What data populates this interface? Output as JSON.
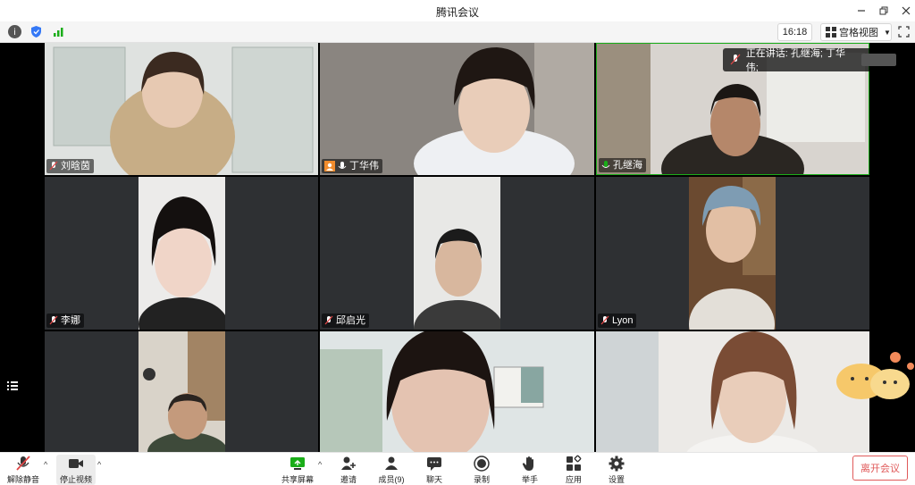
{
  "app": {
    "title": "腾讯会议"
  },
  "toolbar": {
    "time": "16:18",
    "view_label": "宫格视图"
  },
  "speaking": {
    "label": "正在讲话: 孔继海; 丁华伟;"
  },
  "participants": [
    {
      "name": "刘晗茵"
    },
    {
      "name": "丁华伟"
    },
    {
      "name": "孔继海"
    },
    {
      "name": "李娜"
    },
    {
      "name": "邱启光"
    },
    {
      "name": "Lyon"
    }
  ],
  "bottom": {
    "unmute": "解除静音",
    "stop_video": "停止视频",
    "share": "共享屏幕",
    "invite": "邀请",
    "members": "成员(9)",
    "chat": "聊天",
    "record": "录制",
    "raise_hand": "举手",
    "apps": "应用",
    "settings": "设置",
    "leave": "离开会议"
  },
  "colors": {
    "accent": "#1aad19",
    "leave": "#e05a5a",
    "tile_bg": "#2e3033"
  }
}
